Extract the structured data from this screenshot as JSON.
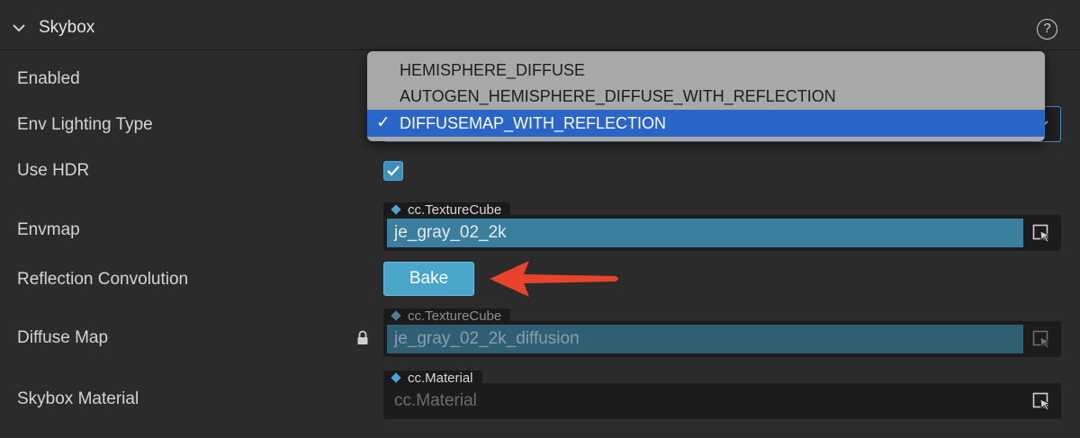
{
  "header": {
    "title": "Skybox",
    "help_icon": "?"
  },
  "rows": {
    "enabled_label": "Enabled",
    "env_lighting_label": "Env Lighting Type",
    "use_hdr_label": "Use HDR",
    "use_hdr_checked": true,
    "envmap_label": "Envmap",
    "reflection_label": "Reflection Convolution",
    "diffuse_label": "Diffuse Map",
    "material_label": "Skybox Material"
  },
  "envmap": {
    "type": "cc.TextureCube",
    "value": "je_gray_02_2k"
  },
  "bake_button": "Bake",
  "diffuse_map": {
    "type": "cc.TextureCube",
    "value": "je_gray_02_2k_diffusion",
    "locked": true
  },
  "skybox_material": {
    "type": "cc.Material",
    "placeholder": "cc.Material"
  },
  "env_lighting_dropdown": {
    "options": [
      {
        "label": "HEMISPHERE_DIFFUSE"
      },
      {
        "label": "AUTOGEN_HEMISPHERE_DIFFUSE_WITH_REFLECTION"
      },
      {
        "label": "DIFFUSEMAP_WITH_REFLECTION"
      }
    ],
    "selected_index": 2,
    "check_mark": "✓"
  },
  "colors": {
    "accent": "#3b8fb8",
    "selected_option": "#2a66c8",
    "annotation_arrow": "#e8432c"
  }
}
